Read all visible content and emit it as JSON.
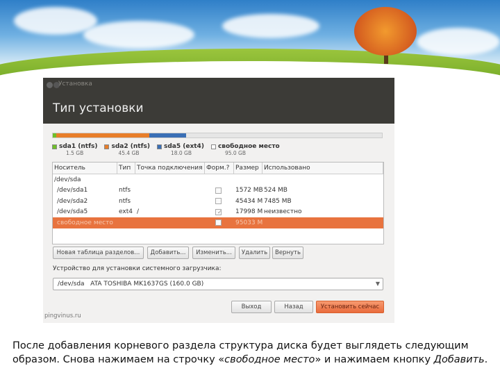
{
  "window": {
    "title": "Установка",
    "heading": "Тип установки"
  },
  "partition_bar": {
    "segments": [
      {
        "color": "#6fbf2a",
        "fraction": 0.01
      },
      {
        "color": "#e87e2a",
        "fraction": 0.284
      },
      {
        "color": "#3a6fb5",
        "fraction": 0.112
      },
      {
        "color": "#e6e6e6",
        "fraction": 0.594
      }
    ]
  },
  "legend": [
    {
      "name": "sda1 (ntfs)",
      "size": "1.5 GB",
      "color": "#6fbf2a"
    },
    {
      "name": "sda2 (ntfs)",
      "size": "45.4 GB",
      "color": "#e87e2a"
    },
    {
      "name": "sda5 (ext4)",
      "size": "18.0 GB",
      "color": "#3a6fb5"
    },
    {
      "name": "свободное место",
      "size": "95.0 GB",
      "color": "#ffffff"
    }
  ],
  "table": {
    "headers": [
      "Носитель",
      "Тип",
      "Точка подключения",
      "Форм.?",
      "Размер",
      "Использовано"
    ],
    "rows": [
      {
        "device": "/dev/sda",
        "type": "",
        "mount": "",
        "format": null,
        "size": "",
        "used": ""
      },
      {
        "device": "/dev/sda1",
        "type": "ntfs",
        "mount": "",
        "format": false,
        "size": "1572 MB",
        "used": "524 MB"
      },
      {
        "device": "/dev/sda2",
        "type": "ntfs",
        "mount": "",
        "format": false,
        "size": "45434 MB",
        "used": "7485 MB"
      },
      {
        "device": "/dev/sda5",
        "type": "ext4",
        "mount": "/",
        "format": true,
        "size": "17998 MB",
        "used": "неизвестно"
      },
      {
        "device": "свободное место",
        "type": "",
        "mount": "",
        "format": false,
        "size": "95033 MB",
        "used": "",
        "selected": true
      }
    ]
  },
  "buttons": {
    "new_table": "Новая таблица разделов...",
    "add": "Добавить...",
    "change": "Изменить...",
    "delete": "Удалить",
    "revert": "Вернуть"
  },
  "bootloader": {
    "label": "Устройство для установки системного загрузчика:",
    "value": "/dev/sda   ATA TOSHIBA MK1637GS (160.0 GB)"
  },
  "footer": {
    "quit": "Выход",
    "back": "Назад",
    "install": "Установить сейчас",
    "site": "pingvinus.ru"
  },
  "caption": {
    "text1": "После добавления корневого раздела структура диска будет выглядеть следующим образом. Снова нажимаем на строчку «",
    "em1": "свободное место",
    "text2": "» и нажимаем кнопку ",
    "em2": "Добавить",
    "text3": "."
  }
}
